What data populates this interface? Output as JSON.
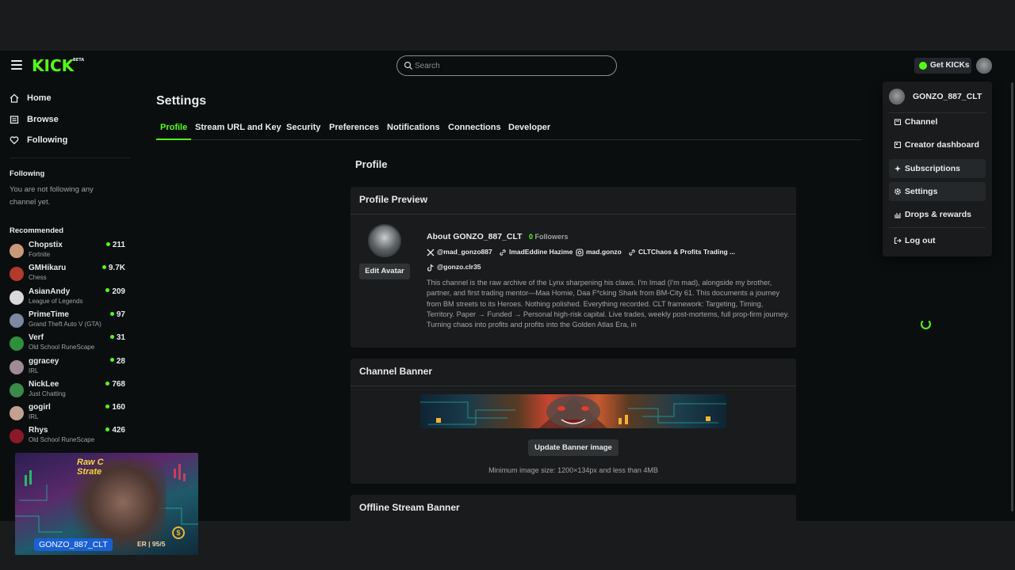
{
  "header": {
    "logo_text": "KICK",
    "logo_badge": "BETA",
    "search_placeholder": "Search",
    "get_kicks_label": "Get KICKs"
  },
  "sidebar": {
    "nav": [
      {
        "label": "Home",
        "icon": "home-icon"
      },
      {
        "label": "Browse",
        "icon": "browse-icon"
      },
      {
        "label": "Following",
        "icon": "heart-icon"
      }
    ],
    "following_heading": "Following",
    "following_empty": "You are not following any channel yet.",
    "recommended_heading": "Recommended",
    "recommended": [
      {
        "name": "Chopstix",
        "game": "Fortnite",
        "viewers": "211"
      },
      {
        "name": "GMHikaru",
        "game": "Chess",
        "viewers": "9.7K"
      },
      {
        "name": "AsianAndy",
        "game": "League of Legends",
        "viewers": "209"
      },
      {
        "name": "PrimeTime",
        "game": "Grand Theft Auto V (GTA)",
        "viewers": "97"
      },
      {
        "name": "Verf",
        "game": "Old School RuneScape",
        "viewers": "31"
      },
      {
        "name": "ggracey",
        "game": "IRL",
        "viewers": "28"
      },
      {
        "name": "NickLee",
        "game": "Just Chatting",
        "viewers": "768"
      },
      {
        "name": "gogirl",
        "game": "IRL",
        "viewers": "160"
      },
      {
        "name": "Rhys",
        "game": "Old School RuneScape",
        "viewers": "426"
      }
    ],
    "avatar_colors": [
      "#c79a7a",
      "#b23a2a",
      "#d9d9d9",
      "#7a8aa0",
      "#2f8f3a",
      "#a08a98",
      "#3a8a4a",
      "#c4a090",
      "#8a1a2a"
    ]
  },
  "settings": {
    "title": "Settings",
    "tabs": [
      "Profile",
      "Stream URL and Key",
      "Security",
      "Preferences",
      "Notifications",
      "Connections",
      "Developer"
    ],
    "active_tab": "Profile",
    "section_title": "Profile",
    "profile_preview": {
      "heading": "Profile Preview",
      "edit_avatar_label": "Edit Avatar",
      "about": "About GONZO_887_CLT",
      "followers_count": "0",
      "followers_label": "Followers",
      "socials": [
        {
          "icon": "x-icon",
          "text": "@mad_gonzo887"
        },
        {
          "icon": "link-icon",
          "text": "ImadEddine Hazime"
        },
        {
          "icon": "instagram-icon",
          "text": "mad.gonzo"
        },
        {
          "icon": "link-icon",
          "text": "CLTChaos & Profits Trading ..."
        }
      ],
      "tiktok": "@gonzo.clr35",
      "bio": "This channel is the raw archive of the Lynx sharpening his claws. I'm Imad (I'm mad), alongside my brother, partner, and first trading mentor—Maa Homie, Daa F*cking Shark from BM-City 61. This documents a journey from BM streets to its Heroes. Nothing polished. Everything recorded. CLT framework: Targeting, Timing, Territory. Paper → Funded → Personal high-risk capital. Live trades, weekly post-mortems, full prop-firm journey. Turning chaos into profits and profits into the Golden Atlas Era, in"
    },
    "channel_banner": {
      "heading": "Channel Banner",
      "update_label": "Update Banner image",
      "min_size": "Minimum image size: 1200×134px and less than 4MB"
    },
    "offline_banner": {
      "heading": "Offline Stream Banner"
    }
  },
  "user_menu": {
    "username": "GONZO_887_CLT",
    "items": [
      {
        "label": "Channel",
        "icon": "channel-icon"
      },
      {
        "label": "Creator dashboard",
        "icon": "dashboard-icon"
      },
      {
        "label": "Subscriptions",
        "icon": "subscriptions-icon"
      },
      {
        "label": "Settings",
        "icon": "gear-icon"
      },
      {
        "label": "Drops & rewards",
        "icon": "drops-icon"
      }
    ],
    "logout_label": "Log out"
  },
  "pip": {
    "overlay_text_1": "Raw C",
    "overlay_text_2": "Strate",
    "channel_tag": "GONZO_887_CLT",
    "score_text": "ER | 95/5",
    "coin_symbol": "$"
  },
  "colors": {
    "accent": "#53fc18",
    "background": "#0b0e0f",
    "surface": "#191b1c"
  }
}
